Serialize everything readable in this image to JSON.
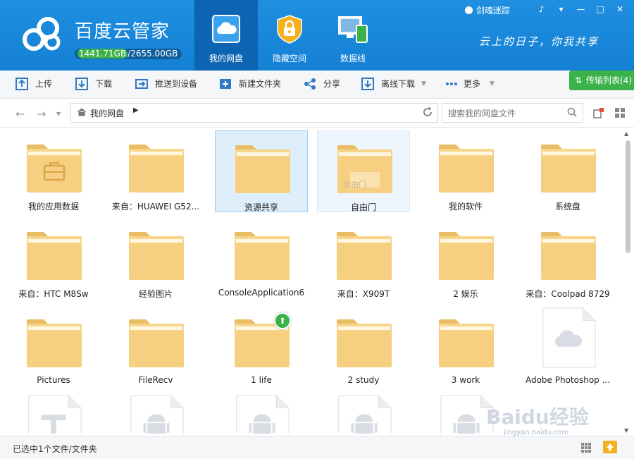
{
  "app": {
    "title": "百度云管家",
    "quota_used": "1441.71GB",
    "quota_total": "/2655.00GB",
    "user_name": "剑魂迷踪",
    "slogan": "云上的日子，你我共享"
  },
  "nav_tabs": [
    {
      "label": "我的网盘",
      "icon": "cloud-drive-icon",
      "active": true
    },
    {
      "label": "隐藏空间",
      "icon": "lock-icon",
      "active": false
    },
    {
      "label": "数据线",
      "icon": "devices-icon",
      "active": false
    }
  ],
  "window_buttons": [
    "bell-icon",
    "menu-icon",
    "minimize-icon",
    "maximize-icon",
    "close-icon"
  ],
  "toolbar": {
    "upload": "上传",
    "download": "下载",
    "push_to_device": "推送到设备",
    "new_folder": "新建文件夹",
    "share": "分享",
    "offline_download": "离线下载",
    "more": "更多",
    "transfer_list": "传输列表(4)"
  },
  "address": {
    "path": "我的网盘",
    "search_placeholder": "搜索我的网盘文件"
  },
  "files": [
    {
      "name": "我的应用数据",
      "type": "app-folder"
    },
    {
      "name": "来自：HUAWEI G52...",
      "type": "folder"
    },
    {
      "name": "资源共享",
      "type": "folder",
      "selected": true
    },
    {
      "name": "自由门",
      "type": "folder",
      "hover": true,
      "overlay": "自由门"
    },
    {
      "name": "我的软件",
      "type": "folder"
    },
    {
      "name": "系统盘",
      "type": "folder"
    },
    {
      "name": "来自：HTC M8Sw",
      "type": "folder"
    },
    {
      "name": "经验图片",
      "type": "folder"
    },
    {
      "name": "ConsoleApplication6",
      "type": "folder"
    },
    {
      "name": "来自：X909T",
      "type": "folder"
    },
    {
      "name": "2 娱乐",
      "type": "folder"
    },
    {
      "name": "来自：Coolpad 8729",
      "type": "folder"
    },
    {
      "name": "Pictures",
      "type": "folder"
    },
    {
      "name": "FileRecv",
      "type": "folder"
    },
    {
      "name": "1 life",
      "type": "folder",
      "badge": "upload"
    },
    {
      "name": "2 study",
      "type": "folder"
    },
    {
      "name": "3 work",
      "type": "folder"
    },
    {
      "name": "Adobe Photoshop ...",
      "type": "cloud-file"
    },
    {
      "name": "",
      "type": "text-file"
    },
    {
      "name": "",
      "type": "android-file"
    },
    {
      "name": "",
      "type": "android-file"
    },
    {
      "name": "",
      "type": "android-file"
    },
    {
      "name": "",
      "type": "android-file"
    }
  ],
  "status": {
    "text": "已选中1个文件/文件夹"
  },
  "watermark": {
    "text": "Baidu经验",
    "url_text": "jingyan.baidu.com"
  },
  "colors": {
    "header_blue": "#1a88dc",
    "active_tab": "#0c64b3",
    "folder": "#f7d58a",
    "transfer_green": "#3bb34a"
  }
}
